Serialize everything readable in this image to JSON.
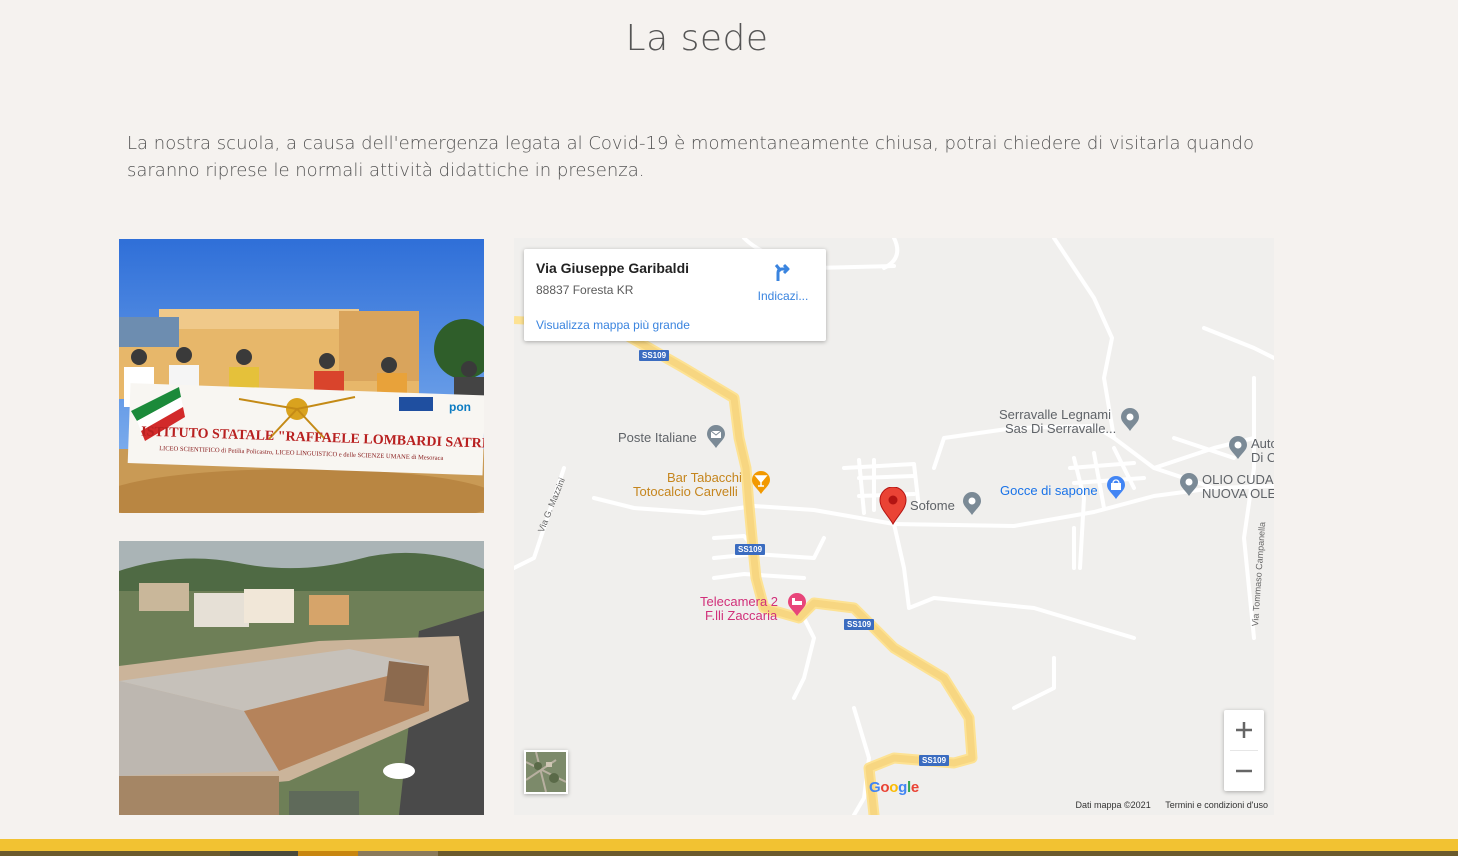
{
  "section": {
    "title": "La sede",
    "intro": "La nostra scuola, a causa dell'emergenza legata al Covid-19 è momentaneamente chiusa, potrai chiedere di visitarla quando saranno riprese le normali attività didattiche in presenza."
  },
  "photos": [
    {
      "banner_text": "ISTITUTO STATALE \"RAFFAELE LOMBARDI SATRIANI\"",
      "banner_subtext": "LICEO SCIENTIFICO di Petilia Policastro, LICEO LINGUISTICO e delle SCIENZE UMANE di Mesoraca",
      "logo_text": "pon"
    },
    {}
  ],
  "map": {
    "card": {
      "place_name": "Via Giuseppe Garibaldi",
      "address": "88837 Foresta KR",
      "directions_label": "Indicazi...",
      "larger_map_link": "Visualizza mappa più grande"
    },
    "road_labels": [
      "SS109",
      "SS109",
      "SS109",
      "SS109"
    ],
    "pois": {
      "poste": "Poste Italiane",
      "bar_line1": "Bar Tabacchi",
      "bar_line2": "Totocalcio Carvelli",
      "serravalle_line1": "Serravalle Legnami",
      "serravalle_line2": "Sas Di Serravalle...",
      "auto_line1": "Auto",
      "auto_line2": "Di C",
      "sofome": "Sofome",
      "gocce": "Gocce di sapone",
      "olio_line1": "OLIO CUDA",
      "olio_line2": "NUOVA OLE",
      "telecamera_line1": "Telecamera 2",
      "telecamera_line2": "F.lli Zaccaria"
    },
    "streets": {
      "mazzini": "Via G. Mazzini",
      "campanella": "Via Tommaso Campanella"
    },
    "zoom_in": "+",
    "zoom_out": "−",
    "google_logo": "Google",
    "attribution": "Dati mappa ©2021",
    "terms": "Termini e condizioni d'uso",
    "colors": {
      "road_main": "#fde293",
      "road_minor": "#ffffff",
      "background": "#f0efed",
      "marker": "#ea4335",
      "link": "#3a84df"
    }
  },
  "footer": {
    "band_color": "#f2c232"
  }
}
